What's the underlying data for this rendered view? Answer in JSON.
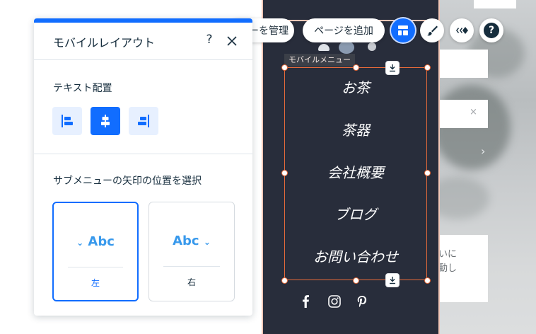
{
  "panel": {
    "title": "モバイルレイアウト",
    "help_glyph": "?",
    "text_align_label": "テキスト配置",
    "text_align_options": [
      {
        "id": "left",
        "selected": false
      },
      {
        "id": "center",
        "selected": true
      },
      {
        "id": "right",
        "selected": false
      }
    ],
    "arrow_position_label": "サブメニューの矢印の位置を選択",
    "arrow_options": [
      {
        "sample": "Abc",
        "caption": "左",
        "selected": true
      },
      {
        "sample": "Abc",
        "caption": "右",
        "selected": false
      }
    ]
  },
  "toolbar": {
    "manage_partial": "ーを管理",
    "add_page": "ページを追加",
    "icons": [
      "layout-icon",
      "paint-brush-icon",
      "animation-icon",
      "help-icon"
    ]
  },
  "canvas": {
    "element_tag": "モバイルメニュー",
    "menu_items": [
      "お茶",
      "茶器",
      "会社概要",
      "ブログ",
      "お問い合わせ"
    ],
    "social_icons": [
      "facebook-icon",
      "instagram-icon",
      "pinterest-icon"
    ],
    "right_text_fragments": [
      "いに",
      "動し"
    ],
    "right_close_glyph": "×",
    "right_chevron_glyph": "›"
  },
  "colors": {
    "accent": "#116dff",
    "menu_background": "#282d3b",
    "selection": "#e86b3a",
    "sample_text": "#3899ec"
  }
}
